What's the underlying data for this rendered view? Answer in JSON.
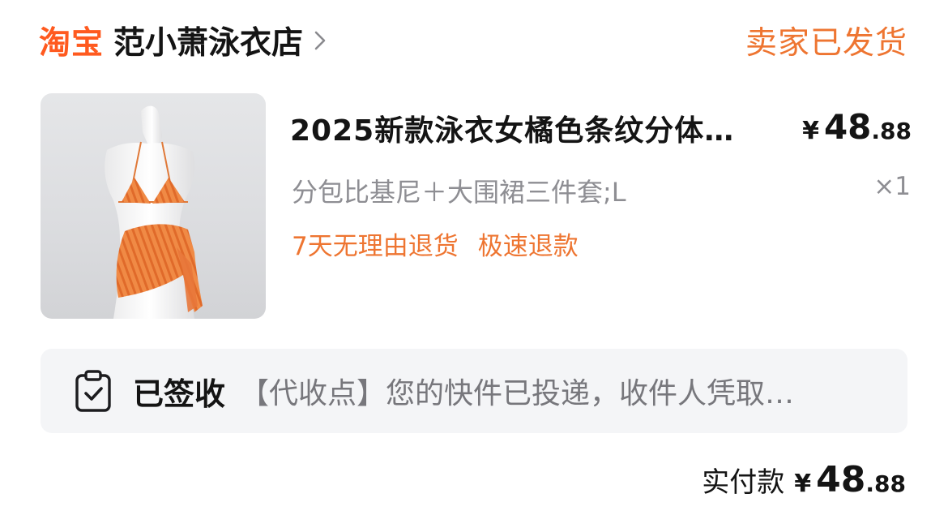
{
  "header": {
    "platform": "淘宝",
    "shop_name": "范小萧泳衣店",
    "order_status": "卖家已发货"
  },
  "product": {
    "image_alt": "orange-striped-bikini-product-photo",
    "title": "2025新款泳衣女橘色条纹分体…",
    "price": {
      "symbol": "¥",
      "integer": "48",
      "decimal": ".88"
    },
    "sku": "分包比基尼＋大围裙三件套;L",
    "quantity": "×1",
    "tags": [
      "7天无理由退货",
      "极速退款"
    ]
  },
  "logistics": {
    "icon": "clipboard-check-icon",
    "label": "已签收",
    "message": "【代收点】您的快件已投递，收件人凭取…"
  },
  "total": {
    "label": "实付款",
    "symbol": "¥",
    "integer": "48",
    "decimal": ".88"
  },
  "colors": {
    "brand": "#ff5a1f",
    "accent": "#ee7531",
    "muted": "#8e8e93",
    "panel": "#f4f5f7"
  }
}
